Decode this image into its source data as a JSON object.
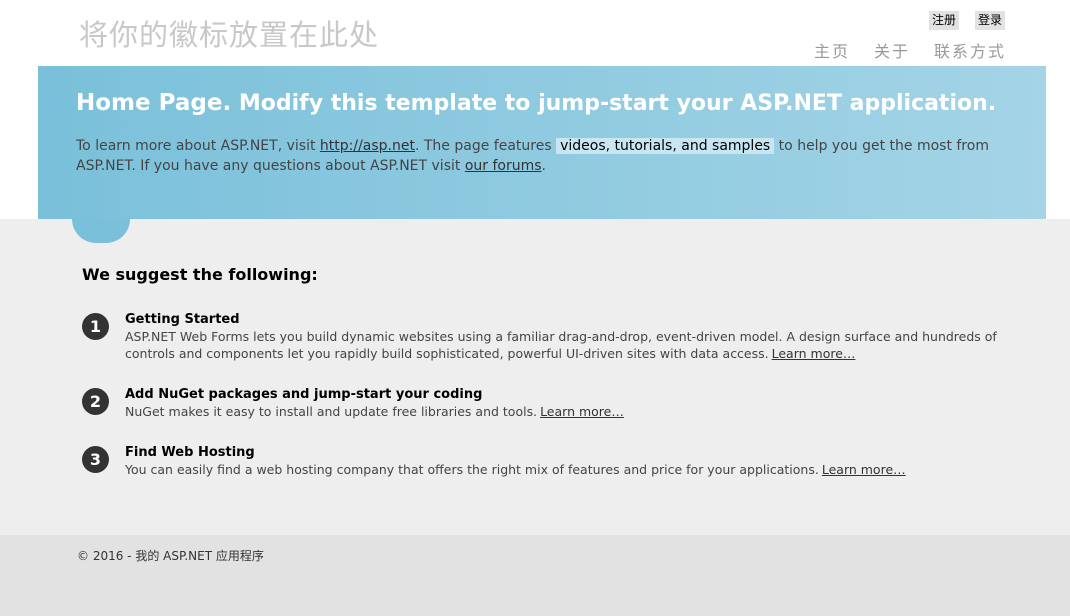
{
  "header": {
    "site_title": "将你的徽标放置在此处",
    "login": {
      "register": "注册",
      "signin": "登录"
    },
    "menu": [
      "主页",
      "关于",
      "联系方式"
    ]
  },
  "featured": {
    "title_bold": "Home Page.",
    "title_rest": "Modify this template to jump-start your ASP.NET application.",
    "text_1": "To learn more about ASP.NET, visit ",
    "link_asp": "http://asp.net",
    "text_2": ". The page features ",
    "mark_text": "videos, tutorials, and samples",
    "text_3": " to help you get the most from ASP.NET. If you have any questions about ASP.NET visit ",
    "link_forums": "our forums",
    "text_4": "."
  },
  "main": {
    "heading": "We suggest the following:",
    "steps": [
      {
        "num": "1",
        "title": "Getting Started",
        "desc": "ASP.NET Web Forms lets you build dynamic websites using a familiar drag-and-drop, event-driven model. A design surface and hundreds of controls and components let you rapidly build sophisticated, powerful UI-driven sites with data access.",
        "link": "Learn more…"
      },
      {
        "num": "2",
        "title": "Add NuGet packages and jump-start your coding",
        "desc": "NuGet makes it easy to install and update free libraries and tools.",
        "link": "Learn more…"
      },
      {
        "num": "3",
        "title": "Find Web Hosting",
        "desc": "You can easily find a web hosting company that offers the right mix of features and price for your applications.",
        "link": "Learn more…"
      }
    ]
  },
  "footer": {
    "text": "© 2016 - 我的 ASP.NET 应用程序"
  }
}
